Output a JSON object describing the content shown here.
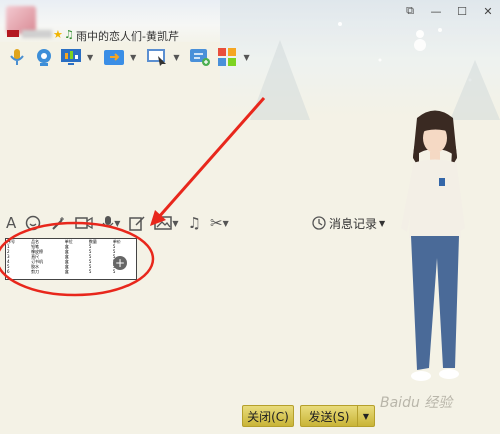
{
  "window": {
    "status_text": "雨中的恋人们-黄凯芹",
    "controls": [
      "restore-icon",
      "minimize-icon",
      "maximize-icon",
      "close-icon"
    ]
  },
  "toolbar": {
    "icons": [
      "microphone-icon",
      "webcam-icon",
      "screen-share-icon",
      "file-transfer-icon",
      "remote-assist-icon",
      "message-icon",
      "apps-icon"
    ]
  },
  "format_bar": {
    "history_label": "消息记录"
  },
  "pasted_table": {
    "headers": [
      "序号",
      "品名",
      "单位",
      "数量",
      "单价"
    ],
    "rows": [
      [
        "1",
        "铅笔",
        "盒",
        "5",
        "5"
      ],
      [
        "2",
        "橡皮擦",
        "盒",
        "5",
        "5"
      ],
      [
        "3",
        "直尺",
        "盒",
        "5",
        "5"
      ],
      [
        "4",
        "订书机",
        "盒",
        "5",
        "5"
      ],
      [
        "5",
        "胶水",
        "盒",
        "5",
        "5"
      ],
      [
        "6",
        "剪刀",
        "盒",
        "5",
        "5"
      ]
    ]
  },
  "buttons": {
    "close_label": "关闭(C)",
    "send_label": "发送(S)"
  },
  "watermark": "Baidu 经验",
  "colors": {
    "annotation": "#e8271c",
    "button": "#d6c657"
  }
}
